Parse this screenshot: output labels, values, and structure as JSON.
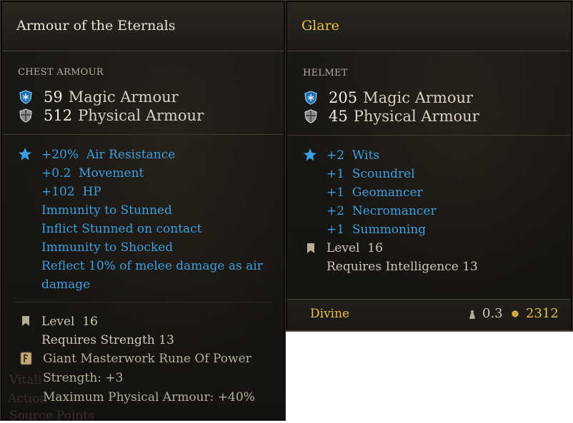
{
  "left": {
    "title": "Armour of the Eternals",
    "category": "CHEST ARMOUR",
    "magic_armour": {
      "value": "59",
      "label": "Magic Armour"
    },
    "physical_armour": {
      "value": "512",
      "label": "Physical Armour"
    },
    "stats": [
      {
        "value": "+20%",
        "label": "Air Resistance"
      },
      {
        "value": "+0.2",
        "label": "Movement"
      },
      {
        "value": "+102",
        "label": "HP"
      }
    ],
    "effects": [
      "Immunity to Stunned",
      "Inflict Stunned on contact",
      "Immunity to Shocked",
      "Reflect 10% of melee damage as air damage"
    ],
    "level_label": "Level",
    "level_value": "16",
    "requirement": "Requires Strength 13",
    "rune_name": "Giant Masterwork Rune Of Power",
    "rune_bonus_1": "Strength: +3",
    "rune_bonus_2": "Maximum Physical Armour: +40%",
    "ghost_1": "Vitali",
    "ghost_2": "Action",
    "ghost_3": "Source Points"
  },
  "right": {
    "title": "Glare",
    "category": "HELMET",
    "magic_armour": {
      "value": "205",
      "label": "Magic Armour"
    },
    "physical_armour": {
      "value": "45",
      "label": "Physical Armour"
    },
    "stats": [
      {
        "value": "+2",
        "label": "Wits"
      },
      {
        "value": "+1",
        "label": "Scoundrel"
      },
      {
        "value": "+1",
        "label": "Geomancer"
      },
      {
        "value": "+2",
        "label": "Necromancer"
      },
      {
        "value": "+1",
        "label": "Summoning"
      }
    ],
    "level_label": "Level",
    "level_value": "16",
    "requirement": "Requires Intelligence 13",
    "rarity": "Divine",
    "weight": "0.3",
    "gold": "2312"
  },
  "colors": {
    "stat_blue": "#3e9fe0",
    "rarity_gold": "#e6c24a",
    "text_light": "#d8d0c1"
  },
  "icons": [
    "magic-armour-icon",
    "physical-armour-icon",
    "star-icon",
    "bookmark-icon",
    "rune-icon",
    "weight-icon",
    "coin-icon"
  ]
}
